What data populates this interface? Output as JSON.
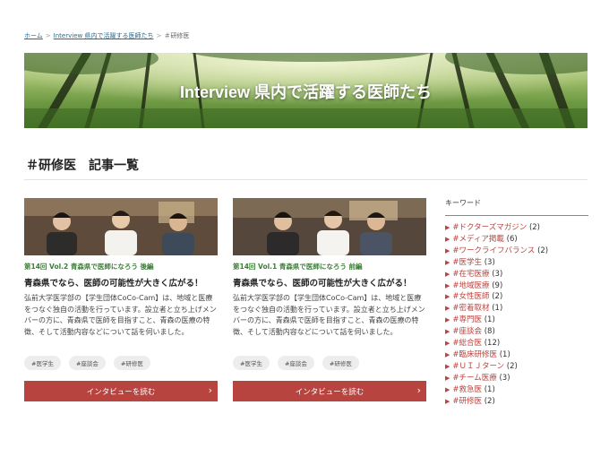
{
  "breadcrumb": {
    "home": "ホーム",
    "sep1": ">",
    "section": "Interview 県内で活躍する医師たち",
    "sep2": ">",
    "current": "＃研修医"
  },
  "hero": {
    "title": "Interview 県内で活躍する医師たち"
  },
  "page_title": "＃研修医　記事一覧",
  "cards": [
    {
      "kicker": "第14回 Vol.2 青森県で医師になろう 後編",
      "headline": "青森県でなら、医師の可能性が大きく広がる！",
      "body": "弘前大学医学部の【学生団体CoCo-Cam】は、地域と医療をつなぐ独自の活動を行っています。設立者と立ち上げメンバーの方に、青森県で医師を目指すこと、青森の医療の特徴、そして活動内容などについて話を伺いました。",
      "tags": [
        "#医学生",
        "#座談会",
        "#研修医"
      ],
      "button": "インタビューを読む",
      "chevron": "›"
    },
    {
      "kicker": "第14回 Vol.1 青森県で医師になろう 前編",
      "headline": "青森県でなら、医師の可能性が大きく広がる！",
      "body": "弘前大学医学部の【学生団体CoCo-Cam】は、地域と医療をつなぐ独自の活動を行っています。設立者と立ち上げメンバーの方に、青森県で医師を目指すこと、青森の医療の特徴、そして活動内容などについて話を伺いました。",
      "tags": [
        "#医学生",
        "#座談会",
        "#研修医"
      ],
      "button": "インタビューを読む",
      "chevron": "›"
    }
  ],
  "sidebar": {
    "heading": "キーワード",
    "bullet": "▶",
    "keywords": [
      {
        "label": "#ドクターズマガジン",
        "count": "(2)"
      },
      {
        "label": "#メディア掲載",
        "count": "(6)"
      },
      {
        "label": "#ワークライフバランス",
        "count": "(2)"
      },
      {
        "label": "#医学生",
        "count": "(3)"
      },
      {
        "label": "#在宅医療",
        "count": "(3)"
      },
      {
        "label": "#地域医療",
        "count": "(9)"
      },
      {
        "label": "#女性医師",
        "count": "(2)"
      },
      {
        "label": "#密着取材",
        "count": "(1)"
      },
      {
        "label": "#専門医",
        "count": "(1)"
      },
      {
        "label": "#座談会",
        "count": "(8)"
      },
      {
        "label": "#総合医",
        "count": "(12)"
      },
      {
        "label": "#臨床研修医",
        "count": "(1)"
      },
      {
        "label": "#ＵＩＪターン",
        "count": "(2)"
      },
      {
        "label": "#チーム医療",
        "count": "(3)"
      },
      {
        "label": "#救急医",
        "count": "(1)"
      },
      {
        "label": "#研修医",
        "count": "(2)"
      }
    ]
  },
  "colors": {
    "accent": "#b8443f",
    "kicker_green": "#3e7d3a",
    "link_blue": "#2b6c8f",
    "tag_bg": "#ededed"
  }
}
